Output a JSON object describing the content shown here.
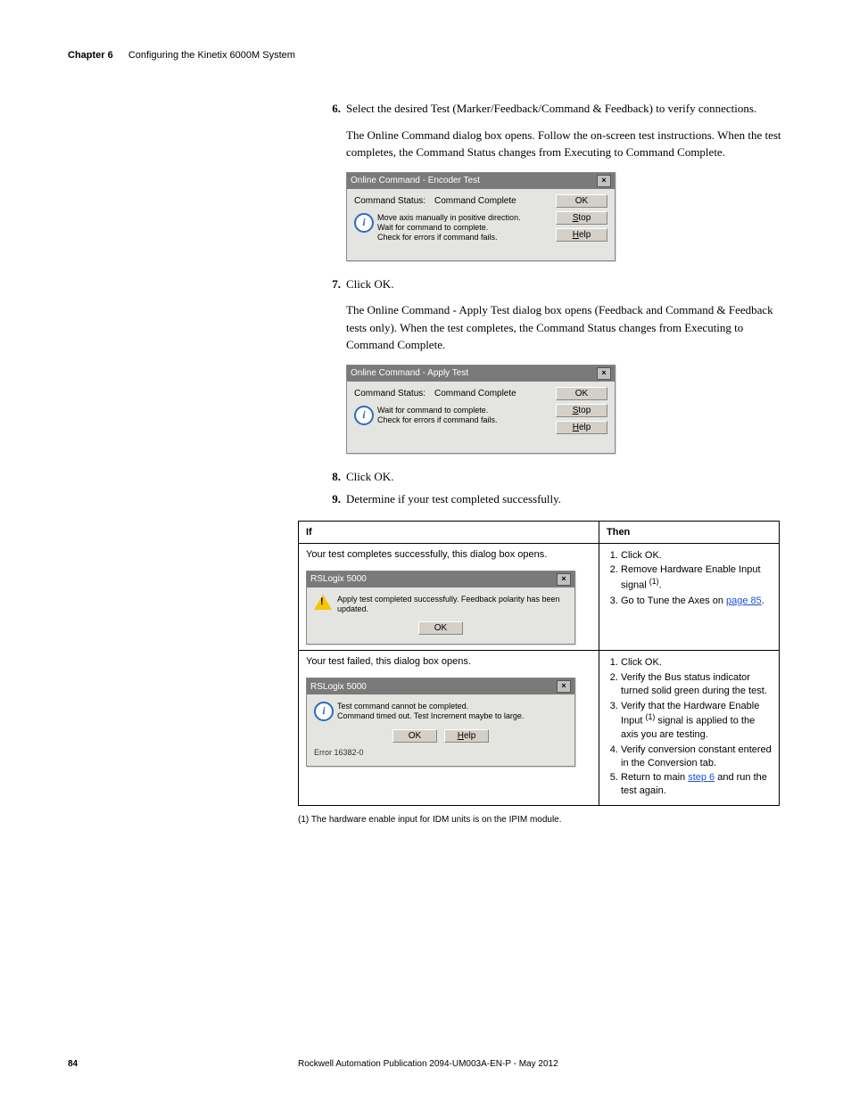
{
  "header": {
    "chapter": "Chapter 6",
    "title": "Configuring the Kinetix 6000M System"
  },
  "steps": {
    "s6": {
      "num": "6.",
      "text": "Select the desired Test (Marker/Feedback/Command & Feedback) to verify connections."
    },
    "s6para": "The Online Command dialog box opens. Follow the on-screen test instructions. When the test completes, the Command Status changes from Executing to Command Complete.",
    "s7": {
      "num": "7.",
      "text": "Click OK."
    },
    "s7para": "The Online Command - Apply Test dialog box opens (Feedback and Command & Feedback tests only). When the test completes, the Command Status changes from Executing to Command Complete.",
    "s8": {
      "num": "8.",
      "text": "Click OK."
    },
    "s9": {
      "num": "9.",
      "text": "Determine if your test completed successfully."
    }
  },
  "dlg1": {
    "title": "Online Command - Encoder Test",
    "statusLabel": "Command Status:",
    "statusValue": "Command Complete",
    "msg": "Move axis manually in positive direction.\nWait for command to complete.\nCheck for errors if command fails.",
    "btnOk": "OK",
    "btnStop": "Stop",
    "btnHelp": "Help"
  },
  "dlg2": {
    "title": "Online Command - Apply Test",
    "statusLabel": "Command Status:",
    "statusValue": "Command Complete",
    "msg": "Wait for command to complete.\nCheck for errors if command fails.",
    "btnOk": "OK",
    "btnStop": "Stop",
    "btnHelp": "Help"
  },
  "table": {
    "hIf": "If",
    "hThen": "Then",
    "row1if": "Your test completes successfully, this dialog box opens.",
    "row1then1": "Click OK.",
    "row1then2a": "Remove Hardware Enable Input signal ",
    "row1then2b": ".",
    "row1then3a": "Go to Tune the Axes on ",
    "row1then3link": "page 85",
    "row1then3b": ".",
    "sup1": "(1)",
    "row2if": "Your test failed, this dialog box opens.",
    "row2then1": "Click OK.",
    "row2then2": "Verify the Bus status indicator turned solid green during the test.",
    "row2then3a": "Verify that the Hardware Enable Input ",
    "row2then3b": " signal is applied to the axis you are testing.",
    "row2then4": "Verify conversion constant entered in the Conversion tab.",
    "row2then5a": "Return to main ",
    "row2then5link": "step 6",
    "row2then5b": " and run the test again."
  },
  "msgbox1": {
    "title": "RSLogix 5000",
    "msg": "Apply test completed successfully. Feedback polarity has been updated.",
    "btnOk": "OK"
  },
  "msgbox2": {
    "title": "RSLogix 5000",
    "msg": "Test command cannot be completed.\nCommand timed out. Test Increment maybe to large.",
    "btnOk": "OK",
    "btnHelp": "Help",
    "err": "Error 16382-0"
  },
  "footnote": "(1)    The hardware enable input for IDM units is on the IPIM module.",
  "footer": {
    "page": "84",
    "pub": "Rockwell Automation Publication 2094-UM003A-EN-P - May 2012"
  }
}
